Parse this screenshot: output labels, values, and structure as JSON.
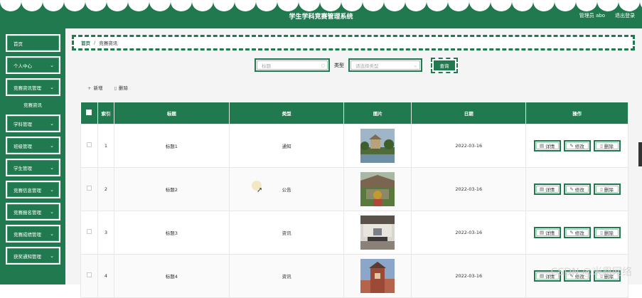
{
  "header": {
    "title": "学生学科竞赛管理系统",
    "role": "管理员",
    "username": "abo",
    "logout": "退出登录"
  },
  "sidebar": {
    "items": [
      {
        "label": "首页",
        "has_chevron": false
      },
      {
        "label": "个人中心",
        "has_chevron": true
      },
      {
        "label": "竞赛资讯管理",
        "has_chevron": true
      },
      {
        "label": "学科管理",
        "has_chevron": true
      },
      {
        "label": "班级管理",
        "has_chevron": true
      },
      {
        "label": "学生管理",
        "has_chevron": true
      },
      {
        "label": "竞赛信息管理",
        "has_chevron": true
      },
      {
        "label": "竞赛报名管理",
        "has_chevron": true
      },
      {
        "label": "竞赛成绩管理",
        "has_chevron": true
      },
      {
        "label": "获奖通知管理",
        "has_chevron": true
      }
    ],
    "submenu": {
      "label": "竞赛资讯",
      "parent_index": 2
    }
  },
  "breadcrumb": {
    "home": "首页",
    "current": "竞赛资讯"
  },
  "search": {
    "title_placeholder": "标题",
    "type_label": "类型",
    "type_placeholder": "请选择类型",
    "query_button": "查询"
  },
  "toolbar": {
    "add": "新增",
    "delete": "删除"
  },
  "table": {
    "headers": [
      "",
      "索引",
      "标题",
      "类型",
      "图片",
      "日期",
      "操作"
    ],
    "rows": [
      {
        "index": "1",
        "title": "标题1",
        "type": "通知",
        "date": "2022-03-16"
      },
      {
        "index": "2",
        "title": "标题2",
        "type": "公告",
        "date": "2022-03-16"
      },
      {
        "index": "3",
        "title": "标题3",
        "type": "资讯",
        "date": "2022-03-16"
      },
      {
        "index": "4",
        "title": "标题4",
        "type": "资讯",
        "date": "2022-03-16"
      }
    ],
    "row_actions": {
      "detail": "详情",
      "edit": "修改",
      "delete": "删除"
    }
  },
  "watermark": "CSDN @米恩网络",
  "colors": {
    "primary": "#217a4f",
    "background": "#f4f4f4"
  }
}
